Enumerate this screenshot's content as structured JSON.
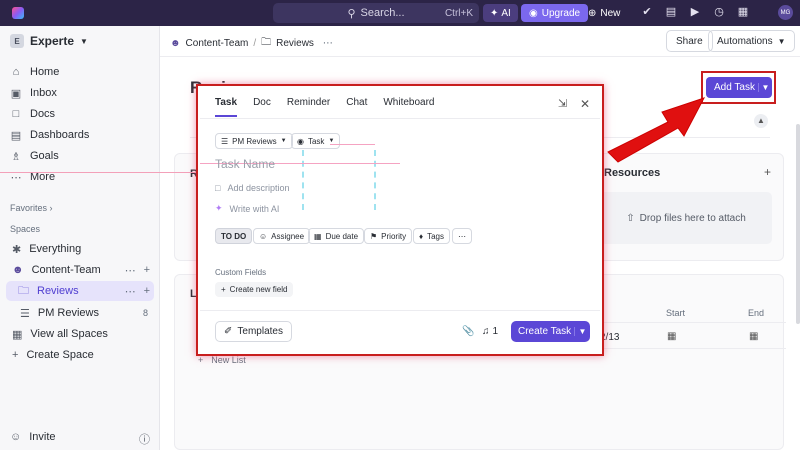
{
  "topbar": {
    "search_label": "Search...",
    "search_shortcut": "Ctrl+K",
    "ai_label": "AI",
    "upgrade_label": "Upgrade",
    "new_label": "New",
    "avatar_initials": "MG"
  },
  "sidebar": {
    "workspace_initial": "E",
    "workspace_name": "Experte",
    "nav": [
      {
        "label": "Home",
        "icon": "home-icon"
      },
      {
        "label": "Inbox",
        "icon": "inbox-icon"
      },
      {
        "label": "Docs",
        "icon": "docs-icon"
      },
      {
        "label": "Dashboards",
        "icon": "dashboard-icon"
      },
      {
        "label": "Goals",
        "icon": "trophy-icon"
      },
      {
        "label": "More",
        "icon": "more-icon"
      }
    ],
    "favorites_label": "Favorites",
    "spaces_label": "Spaces",
    "spaces": [
      {
        "label": "Everything"
      },
      {
        "label": "Content-Team"
      },
      {
        "label": "Reviews"
      },
      {
        "label": "PM Reviews",
        "count": "8"
      },
      {
        "label": "View all Spaces"
      },
      {
        "label": "Create Space"
      }
    ],
    "invite_label": "Invite"
  },
  "main": {
    "breadcrumb_space": "Content-Team",
    "breadcrumb_sep": "/",
    "breadcrumb_folder": "Reviews",
    "share_label": "Share",
    "automations_label": "Automations",
    "page_title": "Reviews",
    "add_task_label": "Add Task",
    "card_left_initial": "Re",
    "resources_title": "Resources",
    "dropzone_label": "Drop files here to attach",
    "list_initial": "Le",
    "col_start": "Start",
    "col_end": "End",
    "row_date": "2/13",
    "new_list_label": "New List"
  },
  "modal": {
    "tabs": [
      "Task",
      "Doc",
      "Reminder",
      "Chat",
      "Whiteboard"
    ],
    "list_select": "PM Reviews",
    "type_select": "Task",
    "task_name_placeholder": "Task Name",
    "add_description": "Add description",
    "write_ai": "Write with AI",
    "chips": [
      "TO DO",
      "Assignee",
      "Due date",
      "Priority",
      "Tags"
    ],
    "custom_fields_label": "Custom Fields",
    "create_field_label": "Create new field",
    "templates_label": "Templates",
    "notif_count": "1",
    "create_task_label": "Create Task"
  },
  "colors": {
    "brand": "#7b68ee",
    "primary_button": "#5b47d6",
    "topbar": "#2c2447",
    "annotation_red": "#e01010"
  }
}
